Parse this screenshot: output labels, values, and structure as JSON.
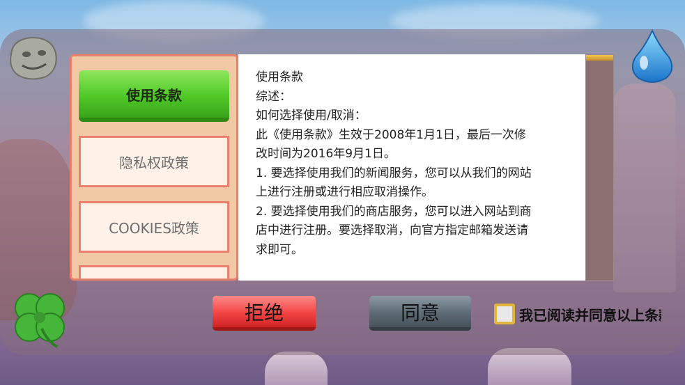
{
  "tabs": [
    {
      "label": "使用条款",
      "active": true
    },
    {
      "label": "隐私权政策",
      "active": false
    },
    {
      "label": "COOKIES政策",
      "active": false
    },
    {
      "label": "",
      "active": false
    }
  ],
  "content": {
    "lines": [
      "使用条款",
      "综述：",
      "",
      "如何选择使用/取消：",
      "此《使用条款》生效于2008年1月1日，最后一次修",
      "改时间为2016年9月1日。",
      "1. 要选择使用我们的新闻服务，您可以从我们的网站",
      "上进行注册或进行相应取消操作。",
      "2. 要选择使用我们的商店服务，您可以进入网站到商",
      "店中进行注册。要选择取消，向官方指定邮箱发送请",
      "求即可。"
    ]
  },
  "buttons": {
    "reject": "拒绝",
    "agree": "同意"
  },
  "agreement": {
    "checked": false,
    "label": "我已阅读并同意以上条款"
  },
  "icons": {
    "top_left": "stone-mascot-icon",
    "top_right": "water-drop-icon",
    "bottom_left": "four-leaf-clover-icon"
  },
  "colors": {
    "active_tab": "#4fc928",
    "tab_border": "#ea7f6c",
    "reject_button": "#f24343",
    "agree_button": "#5d6b74",
    "checkbox_border": "#e1b43a"
  }
}
